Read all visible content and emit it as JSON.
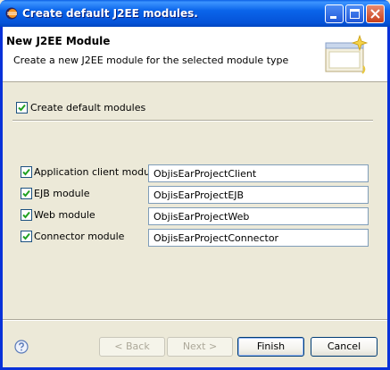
{
  "window": {
    "title": "Create default J2EE modules."
  },
  "banner": {
    "title": "New J2EE Module",
    "description": "Create a new J2EE module for the selected module type"
  },
  "create_default": {
    "label": "Create default modules",
    "checked": true
  },
  "modules": [
    {
      "label": "Application client module",
      "value": "ObjisEarProjectClient",
      "checked": true
    },
    {
      "label": "EJB module",
      "value": "ObjisEarProjectEJB",
      "checked": true
    },
    {
      "label": "Web module",
      "value": "ObjisEarProjectWeb",
      "checked": true
    },
    {
      "label": "Connector module",
      "value": "ObjisEarProjectConnector",
      "checked": true
    }
  ],
  "buttons": {
    "back": "< Back",
    "next": "Next >",
    "finish": "Finish",
    "cancel": "Cancel"
  },
  "colors": {
    "titlebar": "#0a64ea",
    "checkmark": "#21a121",
    "help": "#5a7ab8"
  },
  "icons": {
    "app": "eclipse-icon",
    "wizard": "wizard-banner-icon",
    "help": "help-icon"
  }
}
